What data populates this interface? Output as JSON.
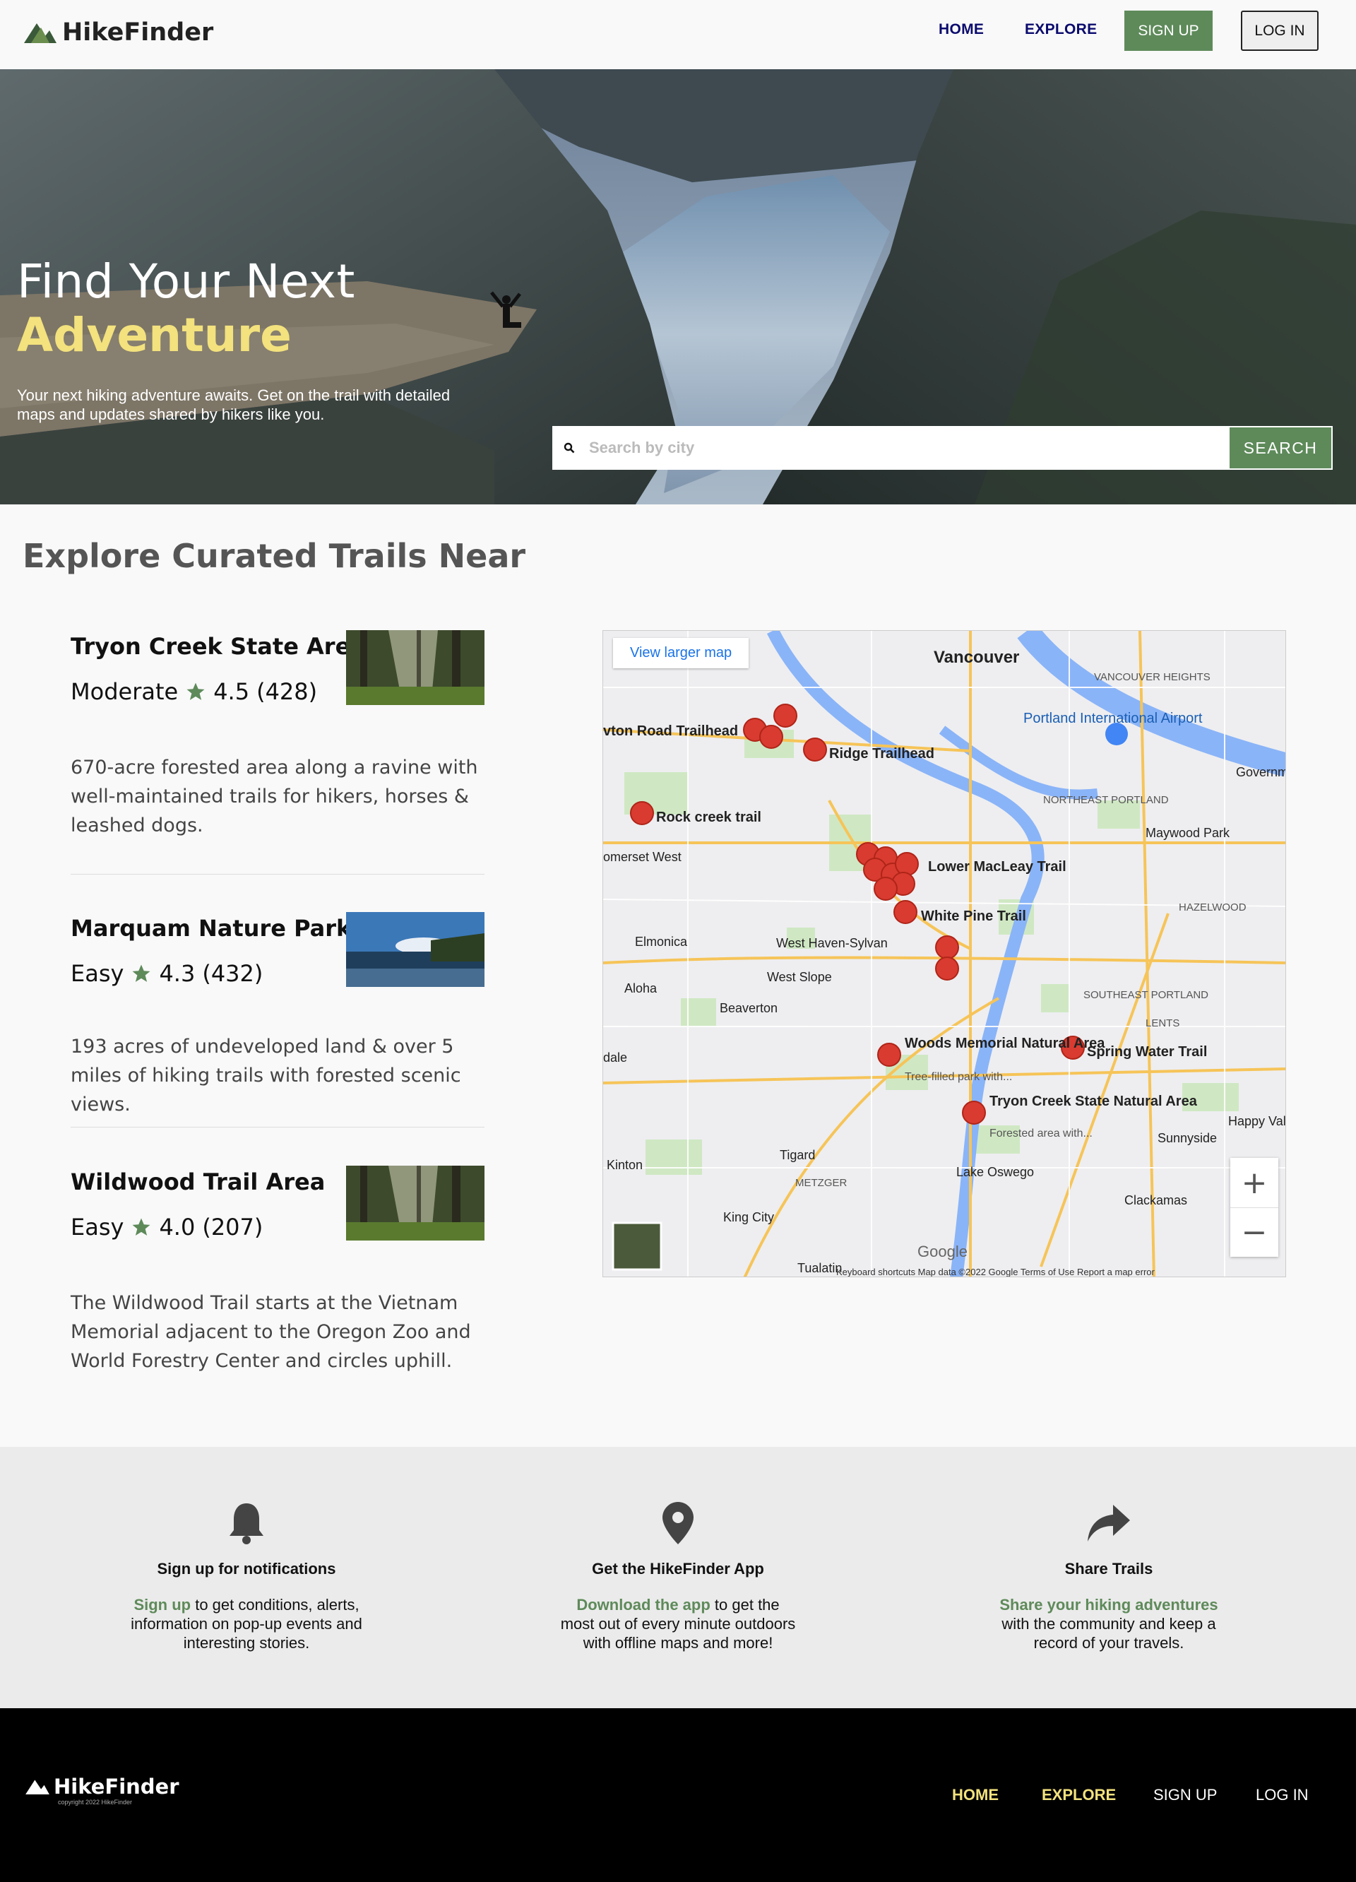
{
  "nav": {
    "brand": "HikeFinder",
    "links": [
      "HOME",
      "EXPLORE"
    ],
    "signup": "SIGN UP",
    "login": "LOG IN"
  },
  "hero": {
    "title_line1": "Find Your Next",
    "title_line2": "Adventure",
    "subtitle": "Your next hiking adventure awaits. Get on the trail with detailed maps and updates shared by hikers like you.",
    "search_placeholder": "Search by city",
    "search_button": "SEARCH"
  },
  "section": {
    "title": "Explore Curated Trails Near"
  },
  "trails": [
    {
      "name": "Tryon Creek State Area",
      "difficulty": "Moderate",
      "rating": "4.5",
      "reviews": "(428)",
      "description": "670-acre forested area along a ravine with well-maintained trails for hikers, horses & leashed dogs."
    },
    {
      "name": "Marquam Nature Park",
      "difficulty": "Easy",
      "rating": "4.3",
      "reviews": "(432)",
      "description": "193 acres of undeveloped land & over 5 miles of hiking trails with forested scenic views."
    },
    {
      "name": "Wildwood Trail Area",
      "difficulty": "Easy",
      "rating": "4.0",
      "reviews": "(207)",
      "description": "The Wildwood Trail starts at the Vietnam Memorial adjacent to the Oregon Zoo and World Forestry Center and circles uphill."
    }
  ],
  "map": {
    "view_larger": "View larger map",
    "labels": [
      "Vancouver",
      "Portland International Airport",
      "Ridge Trailhead",
      "Rock creek trail",
      "Lower MacLeay Trail",
      "White Pine Trail",
      "Woods Memorial Natural Area",
      "Tree-filled park with...",
      "Tryon Creek State Natural Area",
      "Forested area with...",
      "Spring Water Trail",
      "Beaverton",
      "Tigard",
      "Lake Oswego",
      "Clackamas",
      "Happy Vall",
      "Sunnyside",
      "Maywood Park",
      "Aloha",
      "Elmonica",
      "West Slope",
      "King City",
      "Kinton",
      "West Haven-Sylvan",
      "NORTHEAST PORTLAND",
      "SOUTHEAST PORTLAND",
      "HAZELWOOD",
      "METZGER",
      "LENTS",
      "Governm Island",
      "VANCOUVER HEIGHTS",
      "omerset West",
      "vton Road Trailhead",
      "dale",
      "Tualatin",
      "Google"
    ],
    "attribution": "Keyboard shortcuts   Map data ©2022 Google   Terms of Use   Report a map error",
    "zoom_in": "+",
    "zoom_out": "−"
  },
  "features": [
    {
      "icon": "bell-icon",
      "title": "Sign up for notifications",
      "link": "Sign up",
      "text": " to get conditions, alerts, information on pop-up events and interesting stories."
    },
    {
      "icon": "map-pin-icon",
      "title": "Get the HikeFinder App",
      "link": "Download the app",
      "text": " to get the most out of every minute outdoors with offline maps and more!"
    },
    {
      "icon": "share-icon",
      "title": "Share Trails",
      "link": "Share your hiking adventures",
      "text": " with the community and keep a record of your travels."
    }
  ],
  "footer": {
    "brand": "HikeFinder",
    "copyright": "copyright 2022 HikeFinder",
    "links": [
      "HOME",
      "EXPLORE",
      "SIGN UP",
      "LOG IN"
    ]
  },
  "colors": {
    "accent_green": "#5e8a5a",
    "accent_yellow": "#f3e27d",
    "nav_blue": "#0b0b6e"
  }
}
